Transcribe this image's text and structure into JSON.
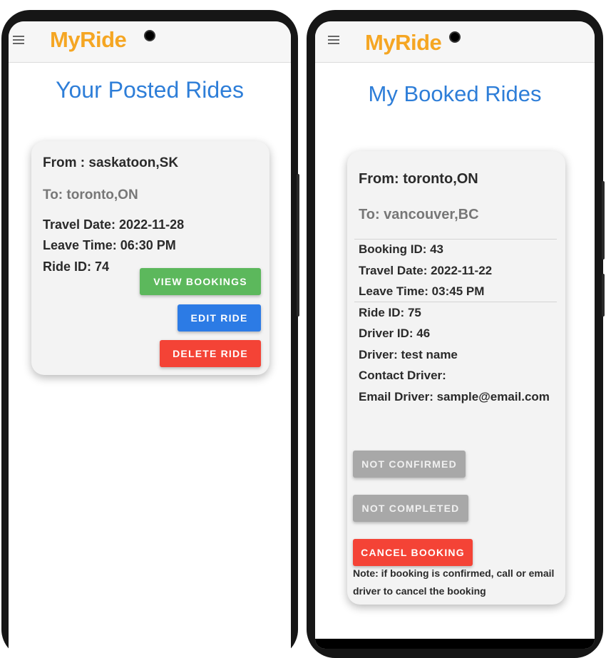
{
  "colors": {
    "brand": "#f5a623",
    "title": "#2e7ed8",
    "view_bookings": "#5cb85c",
    "edit_ride": "#2c7be5",
    "delete_ride": "#f44336",
    "not_confirmed": "#a8a8a8",
    "cancel_booking": "#f44336"
  },
  "left": {
    "app_title": "MyRide",
    "menu_icon": "hamburger-menu-icon",
    "page_title": "Your Posted Rides",
    "card": {
      "from": "From : saskatoon,SK",
      "to": "To: toronto,ON",
      "travel_date": "Travel Date: 2022-11-28",
      "leave_time": "Leave Time: 06:30 PM",
      "ride_id": "Ride ID: 74",
      "view_bookings_label": "VIEW BOOKINGS",
      "edit_ride_label": "EDIT RIDE",
      "delete_ride_label": "DELETE RIDE"
    }
  },
  "right": {
    "app_title": "MyRide",
    "menu_icon": "hamburger-menu-icon",
    "page_title": "My Booked Rides",
    "card": {
      "from": "From: toronto,ON",
      "to": "To: vancouver,BC",
      "booking_id": "Booking ID: 43",
      "travel_date": "Travel Date: 2022-11-22",
      "leave_time": "Leave Time: 03:45 PM",
      "ride_id": "Ride ID: 75",
      "driver_id": "Driver ID: 46",
      "driver": "Driver: test name",
      "contact_driver": "Contact Driver:",
      "email_driver": "Email Driver: sample@email.com",
      "not_confirmed_label": "NOT CONFIRMED",
      "not_completed_label": "NOT COMPLETED",
      "cancel_booking_label": "CANCEL BOOKING",
      "note_line1": "Note: if booking is confirmed, call or email",
      "note_line2": "driver to cancel the booking"
    }
  }
}
